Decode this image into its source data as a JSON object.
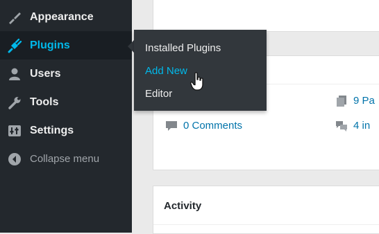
{
  "sidebar": {
    "items": [
      {
        "label": "Appearance",
        "icon": "brush-icon"
      },
      {
        "label": "Plugins",
        "icon": "plugin-plug-icon",
        "active": true
      },
      {
        "label": "Users",
        "icon": "user-icon"
      },
      {
        "label": "Tools",
        "icon": "wrench-icon"
      },
      {
        "label": "Settings",
        "icon": "settings-sliders-icon"
      },
      {
        "label": "Collapse menu",
        "icon": "collapse-arrow-icon"
      }
    ]
  },
  "flyout": {
    "items": [
      {
        "label": "Installed Plugins"
      },
      {
        "label": "Add New",
        "hovered": true
      },
      {
        "label": "Editor"
      }
    ]
  },
  "dashboard": {
    "at_a_glance": {
      "comments": "0 Comments",
      "pages": "9 Pa",
      "moderation": "4 in"
    },
    "activity_title": "Activity"
  },
  "colors": {
    "sidebar_bg": "#23282d",
    "flyout_bg": "#32373c",
    "accent": "#00b9eb",
    "link": "#0073aa",
    "content_bg": "#eaeaea"
  }
}
